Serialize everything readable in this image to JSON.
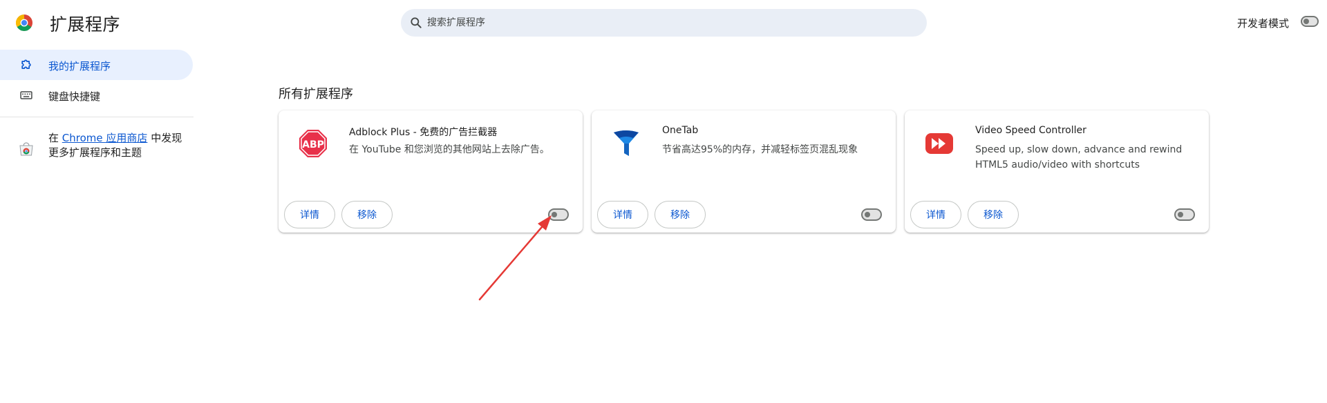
{
  "header": {
    "title": "扩展程序",
    "search_placeholder": "搜索扩展程序",
    "dev_mode_label": "开发者模式",
    "dev_mode_enabled": false
  },
  "sidebar": {
    "items": [
      {
        "label": "我的扩展程序",
        "icon": "puzzle-icon",
        "active": true
      },
      {
        "label": "键盘快捷键",
        "icon": "keyboard-icon",
        "active": false
      }
    ],
    "store_prefix": "在",
    "store_link": "Chrome 应用商店",
    "store_suffix": "中发现更多扩展程序和主题"
  },
  "main": {
    "section_title": "所有扩展程序",
    "extensions": [
      {
        "name": "Adblock Plus - 免费的广告拦截器",
        "description": "在 YouTube 和您浏览的其他网站上去除广告。",
        "icon": "abp-icon",
        "enabled": false,
        "details_label": "详情",
        "remove_label": "移除"
      },
      {
        "name": "OneTab",
        "description": "节省高达95%的内存，并减轻标签页混乱现象",
        "icon": "onetab-funnel-icon",
        "enabled": false,
        "details_label": "详情",
        "remove_label": "移除"
      },
      {
        "name": "Video Speed Controller",
        "description": "Speed up, slow down, advance and rewind HTML5 audio/video with shortcuts",
        "icon": "video-speed-icon",
        "enabled": false,
        "details_label": "详情",
        "remove_label": "移除"
      }
    ]
  },
  "colors": {
    "accent": "#0b57d0",
    "active_bg": "#e8f0fe",
    "search_bg": "#e9eef6",
    "annotation_arrow": "#e53935"
  }
}
